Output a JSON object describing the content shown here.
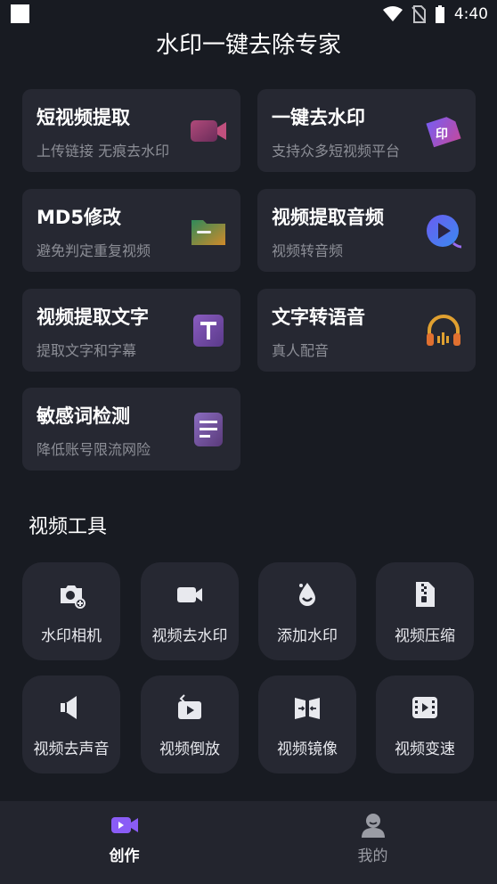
{
  "status_bar": {
    "time": "4:40"
  },
  "header": {
    "title": "水印一键去除专家"
  },
  "features": [
    {
      "title": "短视频提取",
      "subtitle": "上传链接 无痕去水印",
      "icon": "video-camera-icon"
    },
    {
      "title": "一键去水印",
      "subtitle": "支持众多短视频平台",
      "icon": "watermark-eraser-icon"
    },
    {
      "title": "MD5修改",
      "subtitle": "避免判定重复视频",
      "icon": "folder-icon"
    },
    {
      "title": "视频提取音频",
      "subtitle": "视频转音频",
      "icon": "audio-play-icon"
    },
    {
      "title": "视频提取文字",
      "subtitle": "提取文字和字幕",
      "icon": "text-t-icon"
    },
    {
      "title": "文字转语音",
      "subtitle": "真人配音",
      "icon": "headphones-icon"
    },
    {
      "title": "敏感词检测",
      "subtitle": "降低账号限流网险",
      "icon": "document-lines-icon"
    }
  ],
  "tools_section": {
    "title": "视频工具",
    "items": [
      {
        "label": "水印相机",
        "icon": "camera-plus-icon"
      },
      {
        "label": "视频去水印",
        "icon": "video-camera-icon"
      },
      {
        "label": "添加水印",
        "icon": "water-drop-icon"
      },
      {
        "label": "视频压缩",
        "icon": "zip-file-icon"
      },
      {
        "label": "视频去声音",
        "icon": "speaker-mute-icon"
      },
      {
        "label": "视频倒放",
        "icon": "rewind-play-icon"
      },
      {
        "label": "视频镜像",
        "icon": "mirror-icon"
      },
      {
        "label": "视频变速",
        "icon": "film-speed-icon"
      }
    ]
  },
  "bottom_nav": {
    "items": [
      {
        "label": "创作",
        "icon": "create-video-icon",
        "active": true
      },
      {
        "label": "我的",
        "icon": "profile-icon",
        "active": false
      }
    ]
  },
  "colors": {
    "background": "#181b22",
    "card": "#262832",
    "nav": "#23252e",
    "accent": "#8a5cf6",
    "nav_inactive": "#9a9ca4"
  }
}
